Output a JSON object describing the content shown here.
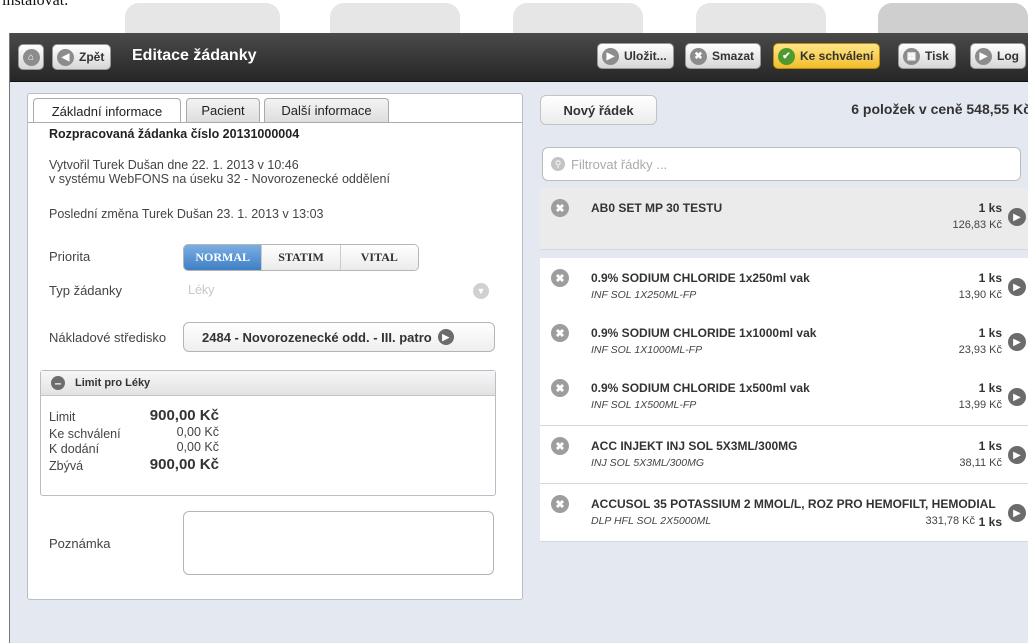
{
  "caption": "instalovat.",
  "toolbar": {
    "back_label": "Zpět",
    "title": "Editace žádanky",
    "buttons": {
      "save": "Uložit...",
      "delete": "Smazat",
      "approve": "Ke schválení",
      "print": "Tisk",
      "log": "Log"
    }
  },
  "tabs": [
    "Základní informace",
    "Pacient",
    "Další informace"
  ],
  "request": {
    "heading": "Rozpracovaná žádanka číslo 20131000004",
    "created_line1": "Vytvořil Turek Dušan dne 22. 1. 2013 v 10:46",
    "created_line2": "v systému WebFONS na úseku 32 - Novorozenecké oddělení",
    "last_change": "Poslední změna Turek Dušan 23. 1. 2013 v 13:03"
  },
  "form": {
    "priority_label": "Priorita",
    "priority_options": [
      "NORMAL",
      "STATIM",
      "VITAL"
    ],
    "priority_selected": "NORMAL",
    "type_label": "Typ žádanky",
    "type_value": "Léky",
    "cost_center_label": "Nákladové středisko",
    "cost_center_value": "2484 - Novorozenecké odd. - III. patro",
    "note_label": "Poznámka",
    "note_value": ""
  },
  "limit": {
    "title": "Limit pro Léky",
    "rows": [
      {
        "label": "Limit",
        "value": "900,00 Kč"
      },
      {
        "label": "Ke schválení",
        "value": "0,00 Kč"
      },
      {
        "label": "K dodání",
        "value": "0,00 Kč"
      },
      {
        "label": "Zbývá",
        "value": "900,00 Kč"
      }
    ]
  },
  "list": {
    "new_row_label": "Nový řádek",
    "summary": "6 položek v ceně 548,55 Kč",
    "filter_placeholder": "Filtrovat řádky ...",
    "items": [
      {
        "name": "AB0 SET MP 30 TESTU",
        "sub": "",
        "qty": "1 ks",
        "price": "126,83 Kč"
      },
      {
        "name": "0.9% SODIUM CHLORIDE 1x250ml vak",
        "sub": "INF SOL 1X250ML-FP",
        "qty": "1 ks",
        "price": "13,90 Kč"
      },
      {
        "name": "0.9% SODIUM CHLORIDE 1x1000ml vak",
        "sub": "INF SOL 1X1000ML-FP",
        "qty": "1 ks",
        "price": "23,93 Kč"
      },
      {
        "name": "0.9% SODIUM CHLORIDE 1x500ml vak",
        "sub": "INF SOL 1X500ML-FP",
        "qty": "1 ks",
        "price": "13,99 Kč"
      },
      {
        "name": "ACC INJEKT INJ SOL 5X3ML/300MG",
        "sub": "INJ SOL 5X3ML/300MG",
        "qty": "1 ks",
        "price": "38,11 Kč"
      },
      {
        "name": "ACCUSOL 35 POTASSIUM 2 MMOL/L, ROZ PRO HEMOFILT, HEMODIAL",
        "sub": "DLP HFL SOL 2X5000ML",
        "qty": "1 ks",
        "price": "331,78 Kč"
      }
    ]
  }
}
